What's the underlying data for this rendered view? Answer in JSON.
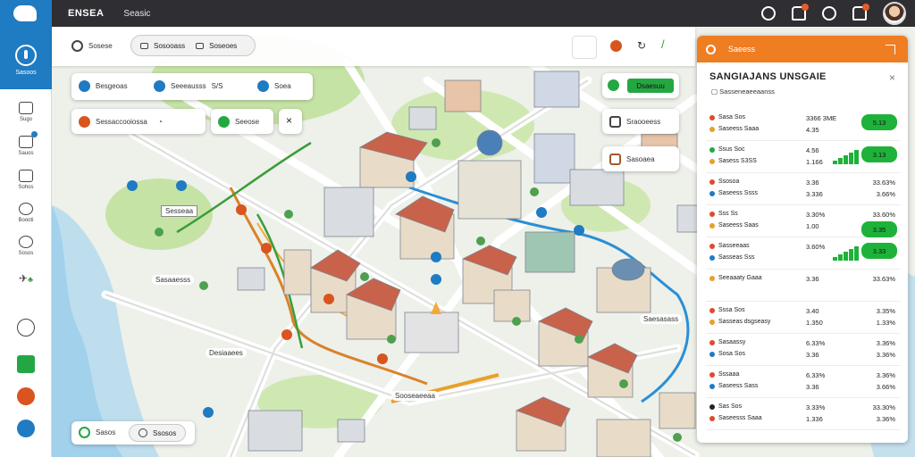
{
  "topbar": {
    "brand": "ENSEA",
    "subtitle": "Seasic"
  },
  "sidebar": {
    "logo_label": "Sasoos",
    "items": [
      {
        "label": "Sugo"
      },
      {
        "label": "Sauos"
      },
      {
        "label": "Sohos"
      },
      {
        "label": "Boooti"
      },
      {
        "label": "Sosos"
      }
    ]
  },
  "tools": {
    "title": "Sosese",
    "pills": [
      "Sosooass",
      "Soseoes"
    ]
  },
  "filters": {
    "chips": [
      "Besgeoas",
      "Seeeausss",
      "Soea"
    ],
    "chip_suffix": "S/S",
    "search_value": "Sessaccooiossa",
    "near": "Seeose",
    "route_btn": "Sageaoess"
  },
  "layer_buttons": [
    {
      "label": "Dsaesuu",
      "color": "#24a743"
    },
    {
      "label": "Sraooeess"
    },
    {
      "label": "Sasoaea"
    }
  ],
  "map_labels": [
    "Sesseaa",
    "Sasaaesss",
    "Desiaaees",
    "Sooseaeeaa",
    "Saesasass"
  ],
  "legend": {
    "a": "Sasos",
    "b": "Ssosos"
  },
  "right_panel": {
    "search_label": "Saeess",
    "title": "SANGIAJANS UNSGAIE",
    "subtitle": "Sasseneaeeaanss",
    "close": "×",
    "rows": [
      {
        "line1": "Sasa Sos",
        "line2": "Saseess Saaa",
        "val1": "3366 3ME",
        "val2": "4.35",
        "badge": "5.13",
        "kind": "badge",
        "c1": "#e04a2a",
        "c2": "#e8a02a"
      },
      {
        "line1": "Ssus Soc",
        "line2": "Sasess S3SS",
        "val1": "4.56",
        "val2": "1.166",
        "badge": "3.13",
        "kind": "bars",
        "c1": "#24a743",
        "c2": "#e8a02a"
      },
      {
        "line1": "Ssosoa",
        "line2": "Saseess Ssss",
        "val1": "3.36",
        "val2": "3.336",
        "pct1": "33.63%",
        "pct2": "3.66%",
        "kind": "pct",
        "c1": "#e04a2a",
        "c2": "#1f7bc2"
      },
      {
        "line1": "Sss Ss",
        "line2": "Saseess Saas",
        "val1": "3.30%",
        "val2": "1.00",
        "badge": "3.35",
        "pct1": "33.60%",
        "kind": "badgepct",
        "c1": "#e04a2a",
        "c2": "#e8a02a"
      },
      {
        "line1": "Sasseeaas",
        "line2": "Sasseas Sss",
        "val1": "3.60%",
        "val2": "",
        "badge": "3.33",
        "kind": "bars",
        "c1": "#e04a2a",
        "c2": "#1f7bc2"
      },
      {
        "line1": "Seeaaaty Gaaa",
        "line2": "",
        "val1": "3.36",
        "val2": "",
        "pct1": "33.63%",
        "kind": "pct",
        "c1": "#e8a02a",
        "c2": "#24a743"
      },
      {
        "line1": "Sssa Sos",
        "line2": "Sasseas dsgseasy",
        "val1": "3.40",
        "val2": "1.350",
        "pct1": "3.35%",
        "pct2": "1.33%",
        "kind": "pct2",
        "c1": "#e04a2a",
        "c2": "#e8a02a"
      },
      {
        "line1": "Sasaassy",
        "line2": "Sosa Sos",
        "val1": "6.33%",
        "val2": "3.36",
        "pct1": "3.36%",
        "pct2": "3.36%",
        "kind": "pct2",
        "c1": "#e04a2a",
        "c2": "#1f7bc2"
      },
      {
        "line1": "Sssaaa",
        "line2": "Saseess Sass",
        "val1": "6.33%",
        "val2": "3.36",
        "pct1": "3.36%",
        "pct2": "3.66%",
        "kind": "pct2",
        "c1": "#e04a2a",
        "c2": "#1f7bc2"
      },
      {
        "line1": "Sas Sos",
        "line2": "Saseesss Saaa",
        "val1": "3.33%",
        "val2": "1.336",
        "pct1": "33.30%",
        "pct2": "3.36%",
        "kind": "pct2",
        "c1": "#222222",
        "c2": "#e04a2a"
      }
    ]
  },
  "colors": {
    "accent": "#ef7d22",
    "brand": "#1f7bc2",
    "good": "#1fb23a"
  }
}
